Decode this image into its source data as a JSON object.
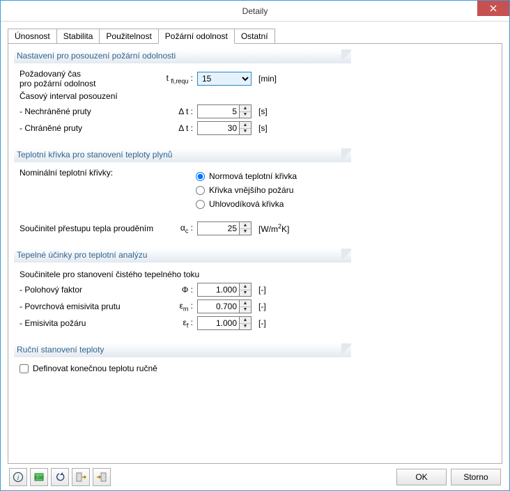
{
  "window": {
    "title": "Detaily"
  },
  "tabs": [
    "Únosnost",
    "Stabilita",
    "Použitelnost",
    "Požární odolnost",
    "Ostatní"
  ],
  "groups": {
    "settings": {
      "title": "Nastavení pro posouzení požární odolnosti",
      "req_time_l1": "Požadovaný čas",
      "req_time_l2": "pro požární odolnost",
      "req_time_value": "15",
      "req_time_unit": "[min]",
      "interval_title": "Časový interval posouzení",
      "unprotected_label": "- Nechráněné pruty",
      "unprotected_value": "5",
      "protected_label": "- Chráněné pruty",
      "protected_value": "30",
      "seconds_unit": "[s]"
    },
    "curve": {
      "title": "Teplotní křivka pro stanovení teploty plynů",
      "nominal_label": "Nominální teplotní křivky:",
      "options": [
        "Normová teplotní křivka",
        "Křivka vnějšího požáru",
        "Uhlovodíková křivka"
      ],
      "alpha_label": "Součinitel přestupu tepla prouděním",
      "alpha_value": "25",
      "alpha_unit": "[W/m2K]"
    },
    "thermal": {
      "title": "Tepelné účinky pro teplotní analýzu",
      "subheading": "Součinitele pro stanovení čistého tepelného toku",
      "phi_label": "- Polohový faktor",
      "phi_value": "1.000",
      "epsm_label": "- Povrchová emisivita prutu",
      "epsm_value": "0.700",
      "epsf_label": "- Emisivita požáru",
      "epsf_value": "1.000",
      "dimless": "[-]"
    },
    "manual": {
      "title": "Ruční stanovení teploty",
      "checkbox_label": "Definovat konečnou teplotu ručně"
    }
  },
  "footer": {
    "ok": "OK",
    "cancel": "Storno"
  }
}
